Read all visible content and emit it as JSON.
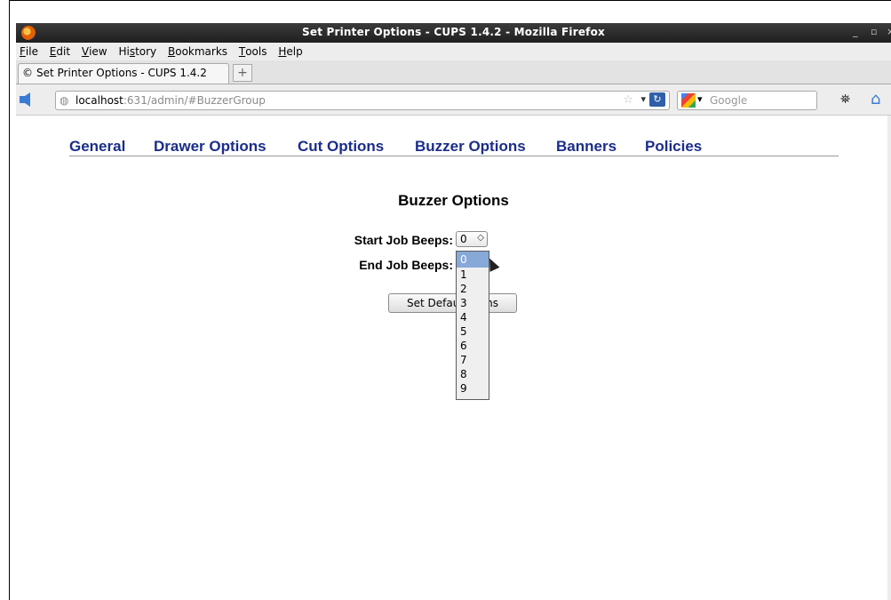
{
  "window": {
    "title": "Set Printer Options - CUPS 1.4.2 - Mozilla Firefox",
    "min_glyph": "_",
    "max_glyph": "▫"
  },
  "menubar": {
    "items": [
      {
        "pre": "",
        "key": "F",
        "post": "ile"
      },
      {
        "pre": "",
        "key": "E",
        "post": "dit"
      },
      {
        "pre": "",
        "key": "V",
        "post": "iew"
      },
      {
        "pre": "Hi",
        "key": "s",
        "post": "tory"
      },
      {
        "pre": "",
        "key": "B",
        "post": "ookmarks"
      },
      {
        "pre": "",
        "key": "T",
        "post": "ools"
      },
      {
        "pre": "",
        "key": "H",
        "post": "elp"
      }
    ]
  },
  "tab": {
    "label": "Set Printer Options - CUPS 1.4.2",
    "new_tab_glyph": "+"
  },
  "navbar": {
    "url_host": "localhost",
    "url_rest": ":631/admin/#BuzzerGroup",
    "search_placeholder": "Google"
  },
  "page": {
    "nav": [
      "General",
      "Drawer Options",
      "Cut Options",
      "Buzzer Options",
      "Banners",
      "Policies"
    ],
    "section_title": "Buzzer Options",
    "start_label": "Start Job Beeps:",
    "end_label": "End Job Beeps:",
    "start_value": "0",
    "button_label": "Set Default Options",
    "button_visible": "Set Defaul     ons",
    "options": [
      "0",
      "1",
      "2",
      "3",
      "4",
      "5",
      "6",
      "7",
      "8",
      "9"
    ],
    "selected_option": "0"
  },
  "colors": {
    "link": "#1b2d8a",
    "selection": "#86a9d8"
  }
}
